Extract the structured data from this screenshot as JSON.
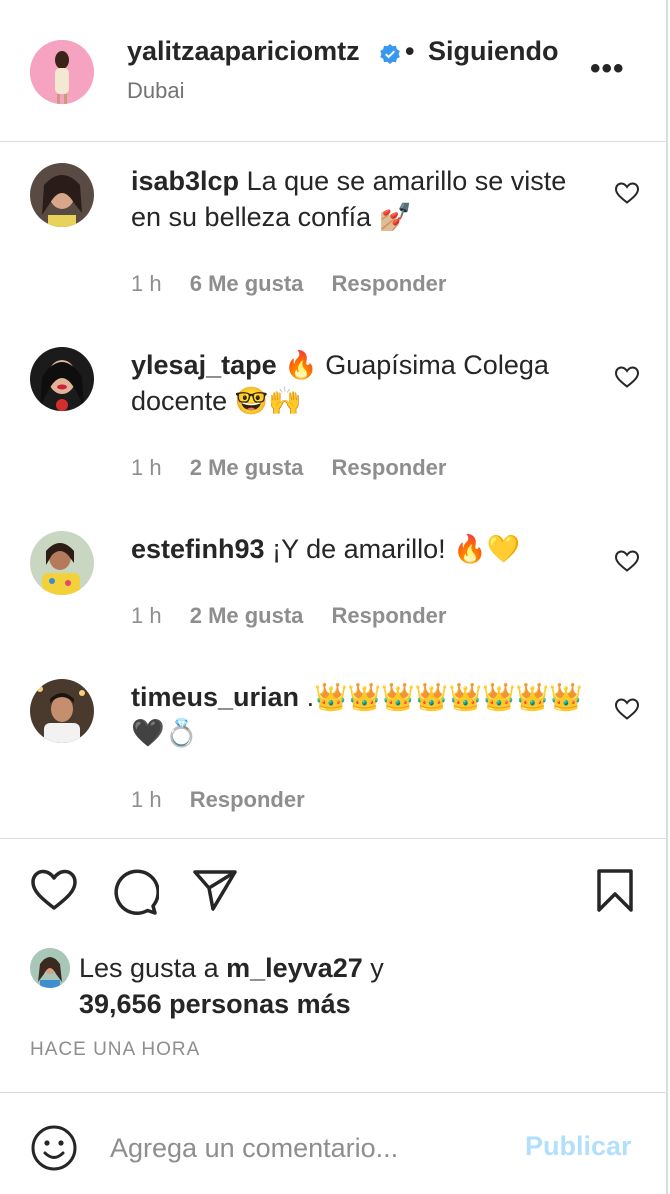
{
  "header": {
    "username": "yalitzaapariciomtz",
    "separator": "•",
    "follow_status": "Siguiendo",
    "location": "Dubai",
    "more": "•••"
  },
  "comments": [
    {
      "username": "isab3lcp",
      "text": "La que se amarillo se viste en su belleza confía 💅🏼",
      "time": "1 h",
      "likes": "6 Me gusta",
      "reply": "Responder"
    },
    {
      "username": "ylesaj_tape",
      "text": "🔥 Guapísima Colega docente 🤓🙌",
      "time": "1 h",
      "likes": "2 Me gusta",
      "reply": "Responder"
    },
    {
      "username": "estefinh93",
      "text": "¡Y de amarillo! 🔥💛",
      "time": "1 h",
      "likes": "2 Me gusta",
      "reply": "Responder"
    },
    {
      "username": "timeus_urian",
      "text": ".👑👑👑👑👑👑👑👑🖤💍",
      "time": "1 h",
      "reply": "Responder"
    }
  ],
  "likes": {
    "prefix": "Les gusta a ",
    "user": "m_leyva27",
    "middle": " y",
    "count": "39,656 personas más"
  },
  "timestamp": "HACE UNA HORA",
  "add_comment": {
    "placeholder": "Agrega un comentario...",
    "publish": "Publicar"
  },
  "colors": {
    "verified": "#3897f0",
    "publish_disabled": "#b2dffc",
    "secondary_text": "#8e8e8e"
  }
}
